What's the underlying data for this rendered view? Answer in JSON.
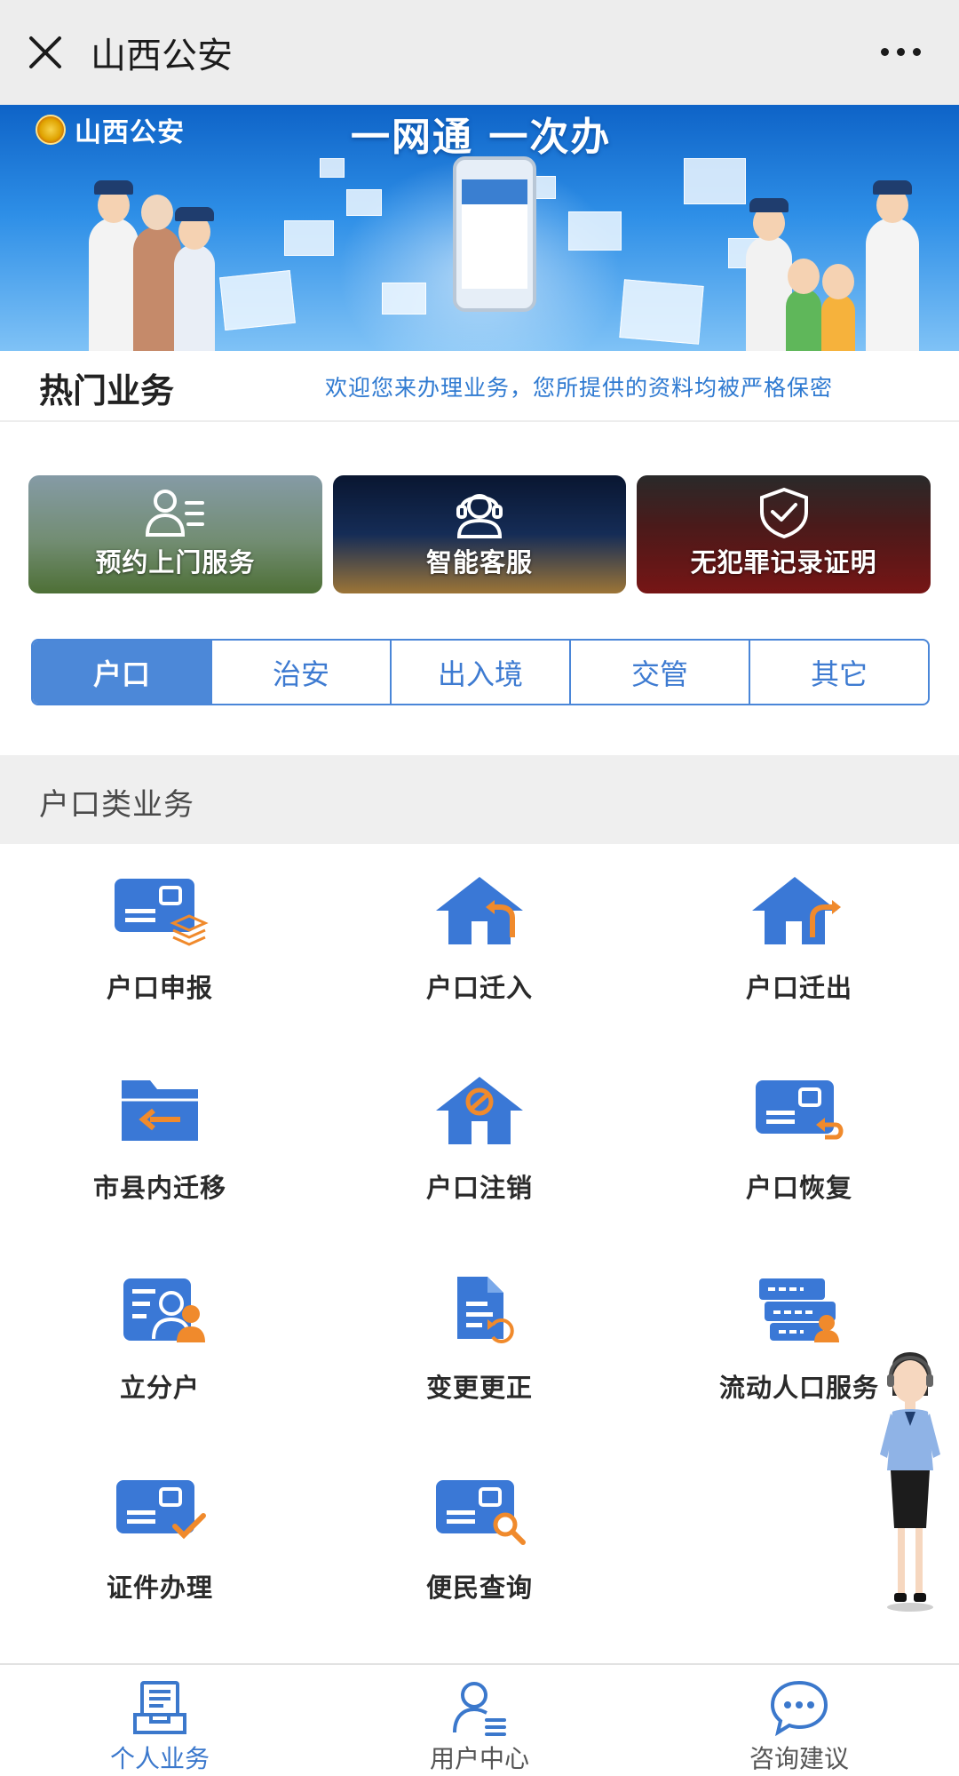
{
  "window": {
    "title": "山西公安",
    "close_icon": "close-icon",
    "more_icon": "more-icon"
  },
  "banner": {
    "logo_text": "山西公安",
    "slogan": "一网通 一次办"
  },
  "hot_section": {
    "title": "热门业务",
    "subtitle": "欢迎您来办理业务，您所提供的资料均被严格保密",
    "tiles": [
      {
        "label": "预约上门服务",
        "icon": "user-list-icon"
      },
      {
        "label": "智能客服",
        "icon": "headset-agent-icon"
      },
      {
        "label": "无犯罪记录证明",
        "icon": "shield-check-icon"
      }
    ]
  },
  "tabs": [
    {
      "label": "户口",
      "active": true
    },
    {
      "label": "治安",
      "active": false
    },
    {
      "label": "出入境",
      "active": false
    },
    {
      "label": "交管",
      "active": false
    },
    {
      "label": "其它",
      "active": false
    }
  ],
  "section": {
    "title": "户口类业务"
  },
  "services": [
    {
      "label": "户口申报",
      "icon": "id-card-layers-icon"
    },
    {
      "label": "户口迁入",
      "icon": "house-arrow-in-icon"
    },
    {
      "label": "户口迁出",
      "icon": "house-arrow-out-icon"
    },
    {
      "label": "市县内迁移",
      "icon": "folder-arrow-icon"
    },
    {
      "label": "户口注销",
      "icon": "house-cancel-icon"
    },
    {
      "label": "户口恢复",
      "icon": "card-restore-icon"
    },
    {
      "label": "立分户",
      "icon": "card-person-icon"
    },
    {
      "label": "变更更正",
      "icon": "document-refresh-icon"
    },
    {
      "label": "流动人口服务",
      "icon": "cards-person-icon"
    },
    {
      "label": "证件办理",
      "icon": "card-check-icon"
    },
    {
      "label": "便民查询",
      "icon": "card-search-icon"
    }
  ],
  "assistant": {
    "icon": "assistant-avatar-icon"
  },
  "bottom_nav": [
    {
      "label": "个人业务",
      "icon": "tray-document-icon",
      "active": true
    },
    {
      "label": "用户中心",
      "icon": "user-list-icon",
      "active": false
    },
    {
      "label": "咨询建议",
      "icon": "chat-bubble-icon",
      "active": false
    }
  ],
  "colors": {
    "accent": "#4c88d8",
    "icon_blue": "#3a78d6",
    "icon_orange": "#f08a2c"
  }
}
